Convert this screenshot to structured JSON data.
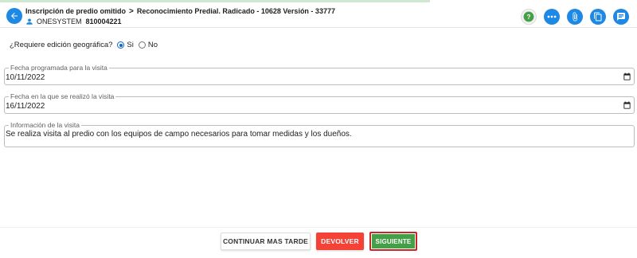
{
  "header": {
    "breadcrumb_1": "Inscripción de predio omitido",
    "separator": ">",
    "breadcrumb_2": "Reconocimiento Predial. Radicado - 10628 Versión - 33777",
    "user_name": "ONESYSTEM",
    "user_code": "810004221"
  },
  "form": {
    "geo_question": "¿Requiere edición geográfica?",
    "geo_options": [
      "Si",
      "No"
    ],
    "geo_selected": "Si",
    "fields": [
      {
        "label": "Fecha programada para la visita",
        "value": "10/11/2022"
      },
      {
        "label": "Fecha en la que se realizó la visita",
        "value": "16/11/2022"
      },
      {
        "label": "Información de la visita",
        "value": "Se realiza visita al predio con los equipos de campo necesarios para tomar medidas y los dueños."
      }
    ]
  },
  "buttons": {
    "later": "CONTINUAR MAS TARDE",
    "back": "DEVOLVER",
    "next": "SIGUIENTE"
  },
  "colors": {
    "primary": "#1e88e5",
    "danger": "#f44336",
    "success": "#43a047",
    "highlight_border": "#c62828"
  },
  "icons": [
    "arrow-left-icon",
    "help-icon",
    "more-horizontal-icon",
    "paperclip-icon",
    "copy-icon",
    "comment-icon",
    "person-icon",
    "calendar-icon"
  ]
}
